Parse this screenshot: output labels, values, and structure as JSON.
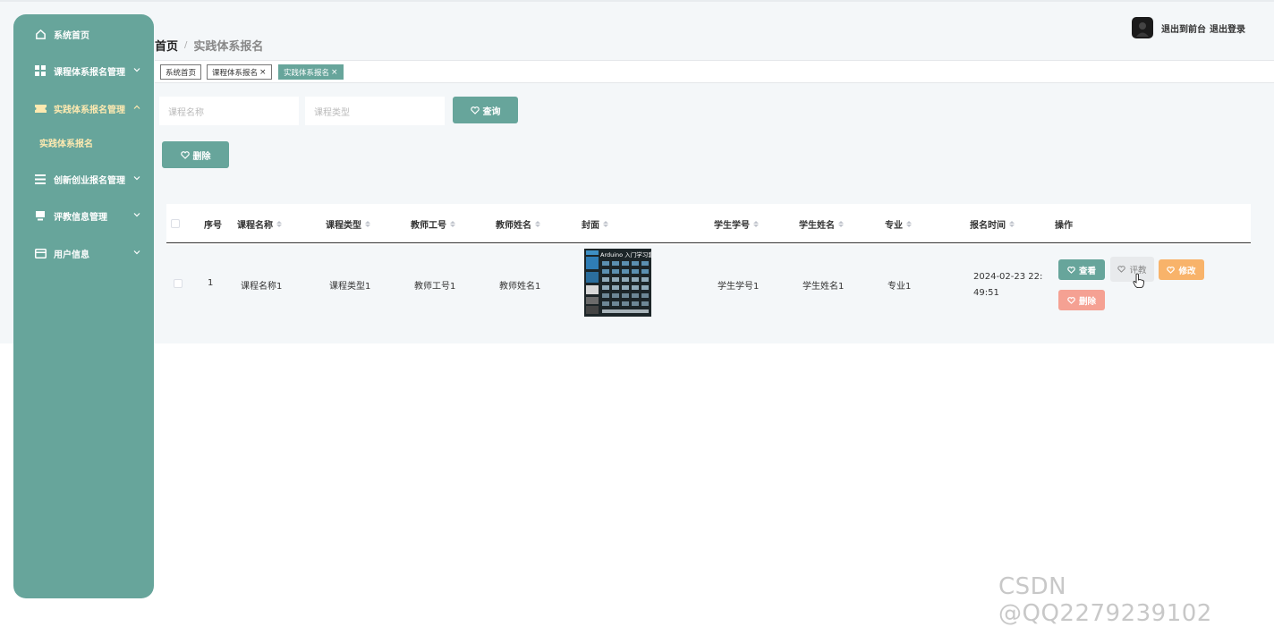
{
  "sidebar": {
    "items": [
      {
        "label": "系统首页",
        "icon": "home-icon",
        "has_chevron": false
      },
      {
        "label": "课程体系报名管理",
        "icon": "grid-icon",
        "has_chevron": true,
        "chevron": "down"
      },
      {
        "label": "实践体系报名管理",
        "icon": "ticket-icon",
        "has_chevron": true,
        "chevron": "up",
        "active": true
      },
      {
        "label": "创新创业报名管理",
        "icon": "list-icon",
        "has_chevron": true,
        "chevron": "down"
      },
      {
        "label": "评教信息管理",
        "icon": "monitor-icon",
        "has_chevron": true,
        "chevron": "down"
      },
      {
        "label": "用户信息",
        "icon": "card-icon",
        "has_chevron": true,
        "chevron": "down"
      }
    ],
    "sub_item": {
      "label": "实践体系报名"
    }
  },
  "breadcrumb": {
    "root": "首页",
    "separator": "/",
    "current": "实践体系报名"
  },
  "header": {
    "back_to_front": "退出到前台",
    "logout": "退出登录"
  },
  "tags": [
    {
      "label": "系统首页",
      "closable": false
    },
    {
      "label": "课程体系报名",
      "closable": true
    },
    {
      "label": "实践体系报名",
      "closable": true,
      "active": true
    }
  ],
  "search": {
    "course_name_placeholder": "课程名称",
    "course_type_placeholder": "课程类型",
    "query_label": "查询"
  },
  "toolbar": {
    "delete_label": "删除"
  },
  "table": {
    "headers": {
      "index": "序号",
      "course_name": "课程名称",
      "course_type": "课程类型",
      "teacher_id": "教师工号",
      "teacher_name": "教师姓名",
      "cover": "封面",
      "student_id": "学生学号",
      "student_name": "学生姓名",
      "major": "专业",
      "signup_time": "报名时间",
      "actions": "操作"
    },
    "rows": [
      {
        "index": "1",
        "course_name": "课程名称1",
        "course_type": "课程类型1",
        "teacher_id": "教师工号1",
        "teacher_name": "教师姓名1",
        "cover_caption": "Arduino 入门学习套装",
        "student_id": "学生学号1",
        "student_name": "学生姓名1",
        "major": "专业1",
        "signup_time_line1": "2024-02-23 22:",
        "signup_time_line2": "49:51",
        "actions": {
          "view": "查看",
          "evaluate": "评教",
          "edit": "修改",
          "delete": "删除"
        }
      }
    ]
  },
  "watermark": "CSDN @QQ2279239102",
  "colors": {
    "primary": "#67a59b",
    "sidebar_active_text": "#fde9b0",
    "edit_button": "#f8b36a",
    "delete_button": "#f5a193",
    "page_background": "#f4f7f9"
  }
}
